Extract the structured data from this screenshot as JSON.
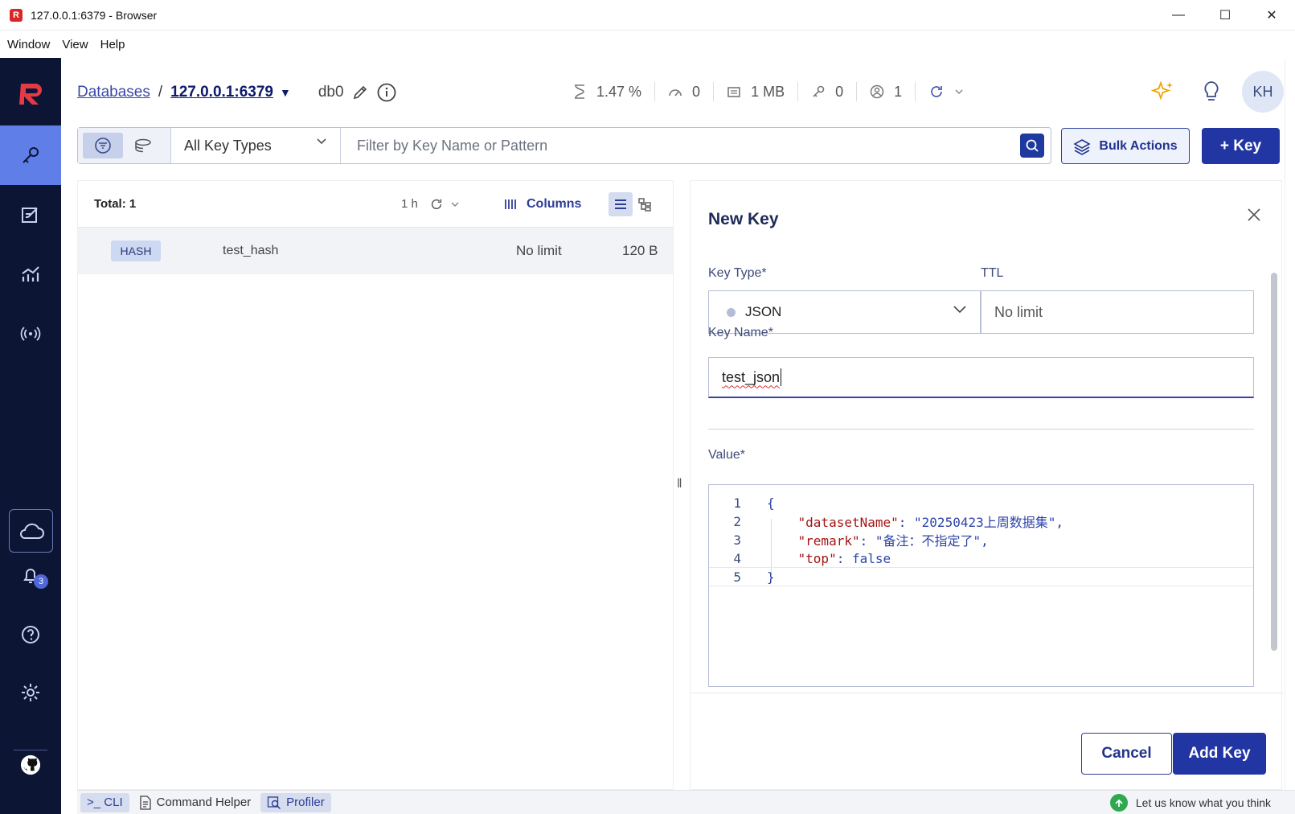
{
  "window": {
    "title": "127.0.0.1:6379 - Browser",
    "app_icon": "R",
    "controls": [
      "—",
      "☐",
      "✕"
    ]
  },
  "menu": [
    "Window",
    "View",
    "Help"
  ],
  "nav": {
    "items": [
      "key-browser",
      "workbench",
      "analytics",
      "pubsub"
    ],
    "bell_count": "3"
  },
  "header": {
    "databases_link": "Databases",
    "separator": "/",
    "current_db": "127.0.0.1:6379",
    "db_index": "db0",
    "stats": {
      "cpu": "1.47 %",
      "ops": "0",
      "memory": "1 MB",
      "keys": "0",
      "clients": "1"
    },
    "avatar": "KH"
  },
  "filter": {
    "key_type": "All Key Types",
    "placeholder": "Filter by Key Name or Pattern",
    "bulk_actions": "Bulk Actions",
    "add_key": "+ Key"
  },
  "keylist": {
    "total": "Total: 1",
    "refresh_interval": "1 h",
    "columns_label": "Columns",
    "rows": [
      {
        "type": "HASH",
        "name": "test_hash",
        "ttl": "No limit",
        "size": "120 B"
      }
    ]
  },
  "new_key": {
    "title": "New Key",
    "key_type_label": "Key Type*",
    "key_type_value": "JSON",
    "ttl_label": "TTL",
    "ttl_value": "No limit",
    "key_name_label": "Key Name*",
    "key_name_value": "test_json",
    "value_label": "Value*",
    "code": [
      {
        "n": "1",
        "parts": [
          [
            "{",
            "punc"
          ]
        ]
      },
      {
        "n": "2",
        "parts": [
          [
            "    ",
            ""
          ],
          [
            "\"datasetName\"",
            "key"
          ],
          [
            ": ",
            "punc"
          ],
          [
            "\"20250423上周数据集\"",
            "str"
          ],
          [
            ",",
            "punc"
          ]
        ]
      },
      {
        "n": "3",
        "parts": [
          [
            "    ",
            ""
          ],
          [
            "\"remark\"",
            "key"
          ],
          [
            ": ",
            "punc"
          ],
          [
            "\"备注：不指定了\"",
            "str"
          ],
          [
            ",",
            "punc"
          ]
        ]
      },
      {
        "n": "4",
        "parts": [
          [
            "    ",
            ""
          ],
          [
            "\"top\"",
            "key"
          ],
          [
            ": ",
            "punc"
          ],
          [
            "false",
            "bool"
          ]
        ]
      },
      {
        "n": "5",
        "parts": [
          [
            "}",
            "punc"
          ]
        ]
      }
    ],
    "cancel": "Cancel",
    "add_key": "Add Key"
  },
  "bottom": {
    "cli": ">_ CLI",
    "command_helper": "Command Helper",
    "profiler": "Profiler",
    "feedback": "Let us know what you think"
  },
  "colors": {
    "nav_bg": "#0d1535",
    "nav_active": "#5f7ee8",
    "primary": "#2236a3"
  }
}
